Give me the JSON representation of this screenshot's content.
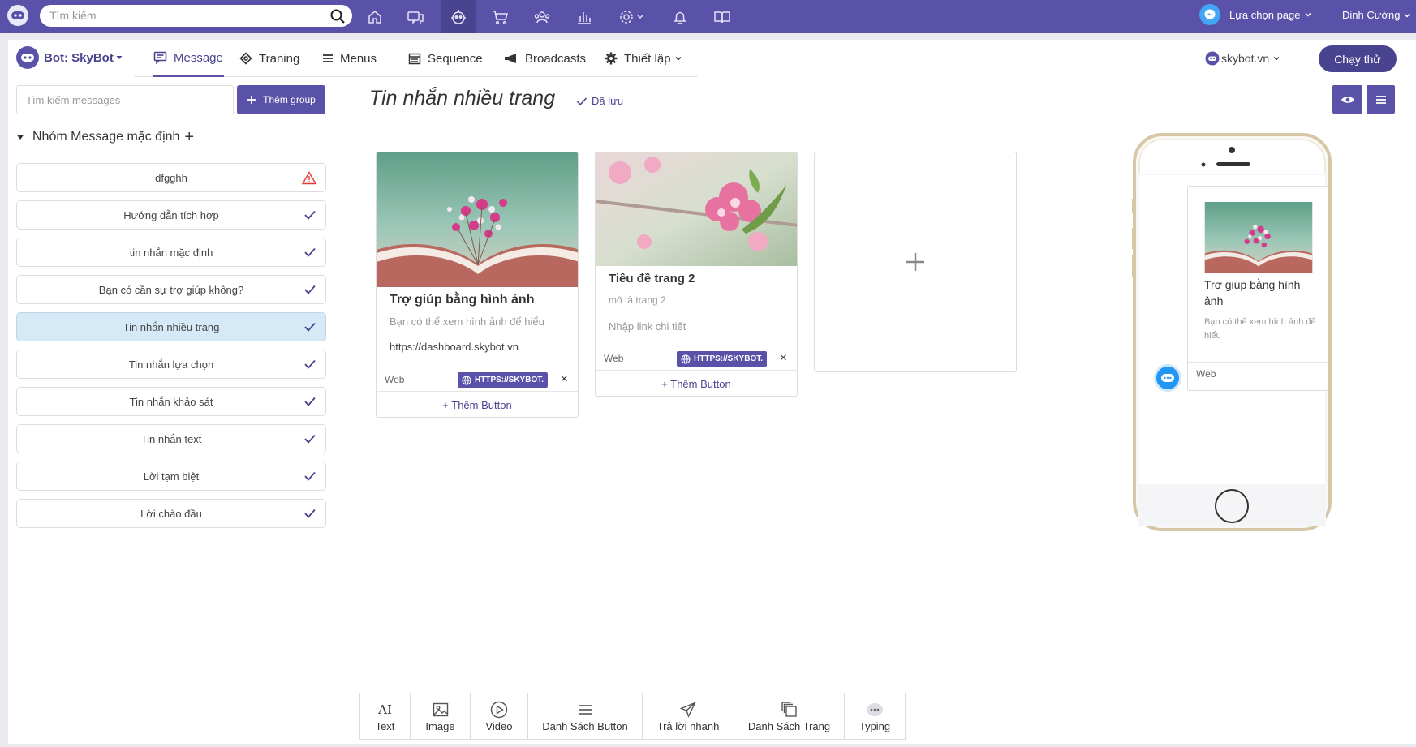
{
  "topbar": {
    "search_placeholder": "Tìm kiếm",
    "page_select_label": "Lựa chọn page",
    "user_name": "Đinh Cường",
    "nav_icons": [
      "home-icon",
      "chat-icon",
      "bot-icon",
      "cart-icon",
      "audience-icon",
      "chart-icon",
      "settings-icon",
      "bell-icon",
      "docs-icon"
    ]
  },
  "header": {
    "bot_label": "Bot: SkyBot",
    "tabs": [
      {
        "label": "Message",
        "icon": "message-icon"
      },
      {
        "label": "Traning",
        "icon": "training-icon"
      },
      {
        "label": "Menus",
        "icon": "menu-icon"
      },
      {
        "label": "Sequence",
        "icon": "calendar-icon"
      },
      {
        "label": "Broadcasts",
        "icon": "megaphone-icon"
      },
      {
        "label": "Thiết lập",
        "icon": "gear-icon"
      }
    ],
    "site_label": "skybot.vn",
    "run_label": "Chạy thử"
  },
  "sidebar": {
    "search_placeholder": "Tìm kiếm messages",
    "add_group_label": "Thêm group",
    "group_title": "Nhóm Message mặc định",
    "items": [
      {
        "label": "dfgghh",
        "status": "warning"
      },
      {
        "label": "Hướng dẫn tích hợp",
        "status": "ok"
      },
      {
        "label": "tin nhắn mặc định",
        "status": "ok"
      },
      {
        "label": "Bạn có cần sự trợ giúp không?",
        "status": "ok"
      },
      {
        "label": "Tin nhắn nhiều trang",
        "status": "ok",
        "active": true
      },
      {
        "label": "Tin nhắn lựa chọn",
        "status": "ok"
      },
      {
        "label": "Tin nhắn khảo sát",
        "status": "ok"
      },
      {
        "label": "Tin nhắn text",
        "status": "ok"
      },
      {
        "label": "Lời tạm biệt",
        "status": "ok"
      },
      {
        "label": "Lời chào đầu",
        "status": "ok"
      }
    ]
  },
  "main": {
    "title": "Tin nhắn nhiều trang",
    "saved_label": "Đã lưu",
    "cards": [
      {
        "title": "Trợ giúp bằng hình ảnh",
        "description": "Bạn có thể xem hình ảnh để hiểu",
        "url": "https://dashboard.skybot.vn",
        "button_type": "Web",
        "button_url": "HTTPS://SKYBOT.",
        "remove_label": "×",
        "add_button_label": "+ Thêm Button"
      },
      {
        "title": "Tiêu đề trang 2",
        "description": "mô tả trang 2",
        "url_placeholder": "Nhập link chi tiết",
        "button_type": "Web",
        "button_url": "HTTPS://SKYBOT.",
        "remove_label": "×",
        "add_button_label": "+ Thêm Button"
      }
    ]
  },
  "preview": {
    "card_title": "Trợ giúp bằng hình ảnh",
    "card_description": "Bạn có thể xem hình ảnh để hiểu",
    "button_label": "Web"
  },
  "toolbar": {
    "items": [
      {
        "label": "Text",
        "icon": "text-ai-icon"
      },
      {
        "label": "Image",
        "icon": "image-icon"
      },
      {
        "label": "Video",
        "icon": "video-icon"
      },
      {
        "label": "Danh Sách Button",
        "icon": "list-icon"
      },
      {
        "label": "Trả lời nhanh",
        "icon": "send-icon"
      },
      {
        "label": "Danh Sách Trang",
        "icon": "pages-icon"
      },
      {
        "label": "Typing",
        "icon": "typing-icon"
      }
    ],
    "text_icon_glyph": "AI"
  },
  "colors": {
    "primary": "#5a52a8",
    "primary_dark": "#4a4390",
    "active_item_bg": "#d5e9f7",
    "warning": "#e53935"
  }
}
